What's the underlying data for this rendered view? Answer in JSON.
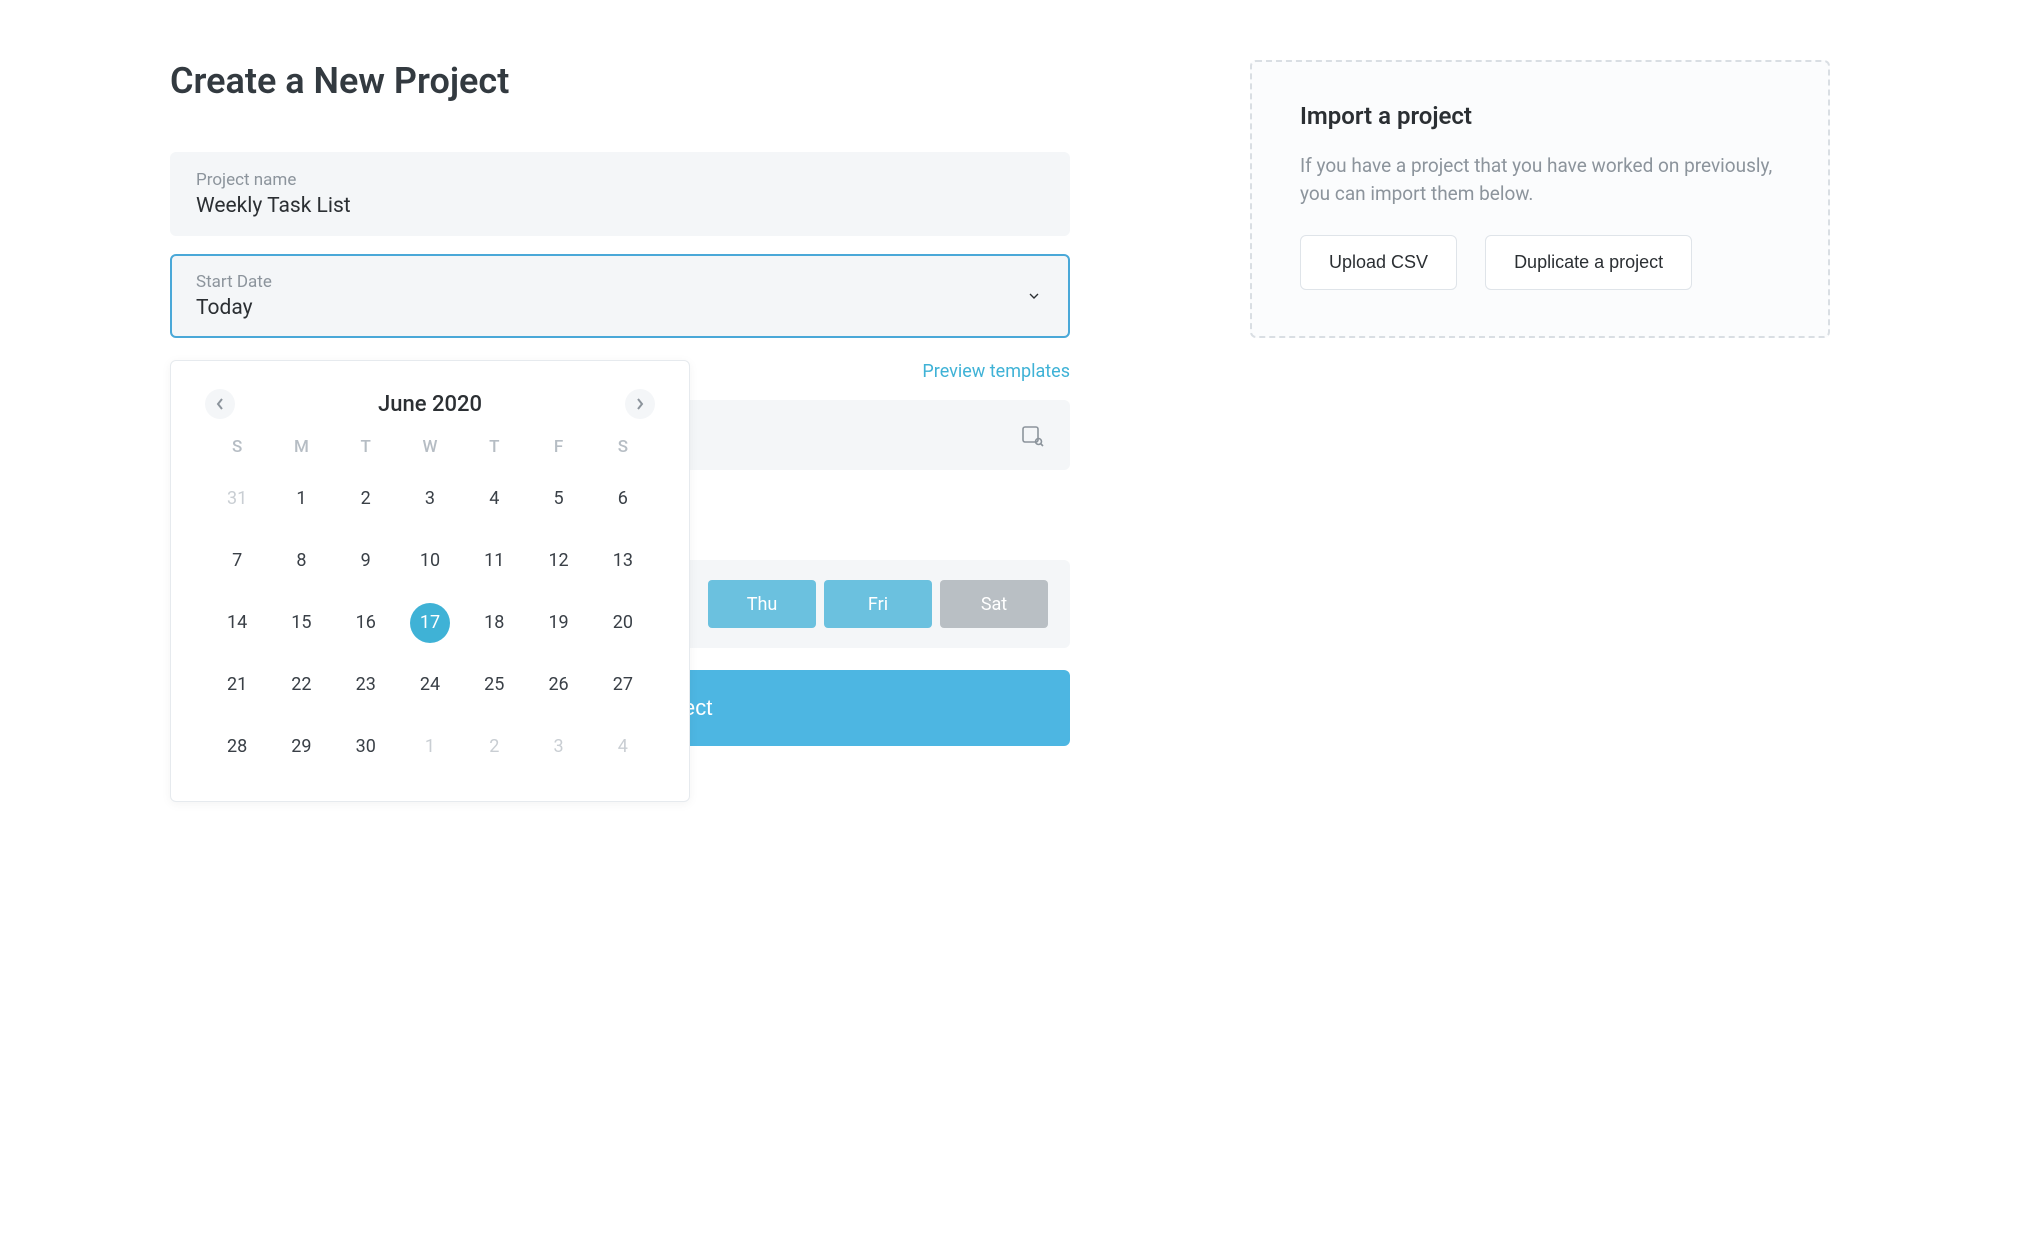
{
  "page": {
    "title": "Create a New Project"
  },
  "fields": {
    "project_name": {
      "label": "Project name",
      "value": "Weekly Task List"
    },
    "start_date": {
      "label": "Start Date",
      "value": "Today"
    }
  },
  "calendar": {
    "title": "June 2020",
    "dow": [
      "S",
      "M",
      "T",
      "W",
      "T",
      "F",
      "S"
    ],
    "weeks": [
      [
        {
          "d": "31",
          "other": true
        },
        {
          "d": "1"
        },
        {
          "d": "2"
        },
        {
          "d": "3"
        },
        {
          "d": "4"
        },
        {
          "d": "5"
        },
        {
          "d": "6"
        }
      ],
      [
        {
          "d": "7"
        },
        {
          "d": "8"
        },
        {
          "d": "9"
        },
        {
          "d": "10"
        },
        {
          "d": "11"
        },
        {
          "d": "12"
        },
        {
          "d": "13"
        }
      ],
      [
        {
          "d": "14"
        },
        {
          "d": "15"
        },
        {
          "d": "16"
        },
        {
          "d": "17",
          "selected": true
        },
        {
          "d": "18"
        },
        {
          "d": "19"
        },
        {
          "d": "20"
        }
      ],
      [
        {
          "d": "21"
        },
        {
          "d": "22"
        },
        {
          "d": "23"
        },
        {
          "d": "24"
        },
        {
          "d": "25"
        },
        {
          "d": "26"
        },
        {
          "d": "27"
        }
      ],
      [
        {
          "d": "28"
        },
        {
          "d": "29"
        },
        {
          "d": "30"
        },
        {
          "d": "1",
          "other": true
        },
        {
          "d": "2",
          "other": true
        },
        {
          "d": "3",
          "other": true
        },
        {
          "d": "4",
          "other": true
        }
      ]
    ]
  },
  "templates": {
    "preview_link": "Preview templates"
  },
  "workdays": [
    {
      "label": "Thu",
      "active": true
    },
    {
      "label": "Fri",
      "active": true
    },
    {
      "label": "Sat",
      "active": false
    }
  ],
  "actions": {
    "create": "Create new project"
  },
  "import": {
    "title": "Import a project",
    "desc": "If you have a project that you have worked on previously, you can import them below.",
    "upload": "Upload CSV",
    "duplicate": "Duplicate a project"
  }
}
